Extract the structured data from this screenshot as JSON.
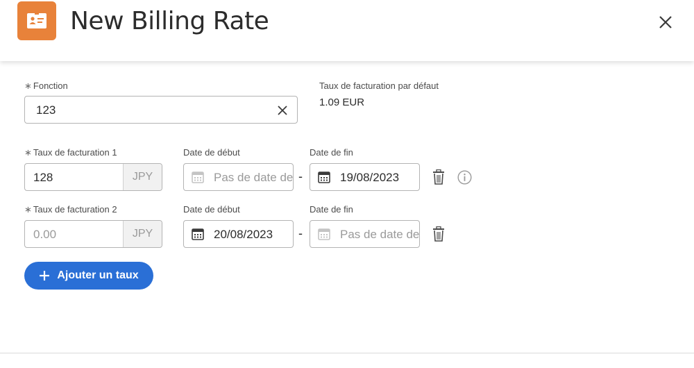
{
  "header": {
    "title": "New Billing Rate",
    "app_icon": "id-badge-icon",
    "accent_color": "#e8823a"
  },
  "fonction": {
    "label": "Fonction",
    "required_mark": "∗",
    "value": "123"
  },
  "default_rate": {
    "label": "Taux de facturation par défaut",
    "value": "1.09 EUR"
  },
  "rates": [
    {
      "label": "Taux de facturation 1",
      "required_mark": "∗",
      "value": "128",
      "currency": "JPY",
      "start_label": "Date de début",
      "start_value": "Pas de date de début",
      "start_is_placeholder": true,
      "end_label": "Date de fin",
      "end_value": "19/08/2023",
      "end_is_placeholder": false,
      "separator": "-"
    },
    {
      "label": "Taux de facturation 2",
      "required_mark": "∗",
      "value": "0.00",
      "currency": "JPY",
      "start_label": "Date de début",
      "start_value": "20/08/2023",
      "start_is_placeholder": false,
      "end_label": "Date de fin",
      "end_value": "Pas de date de fin",
      "end_is_placeholder": true,
      "separator": "-"
    }
  ],
  "add_button": {
    "label": "Ajouter un taux",
    "color": "#2a6fd6"
  }
}
